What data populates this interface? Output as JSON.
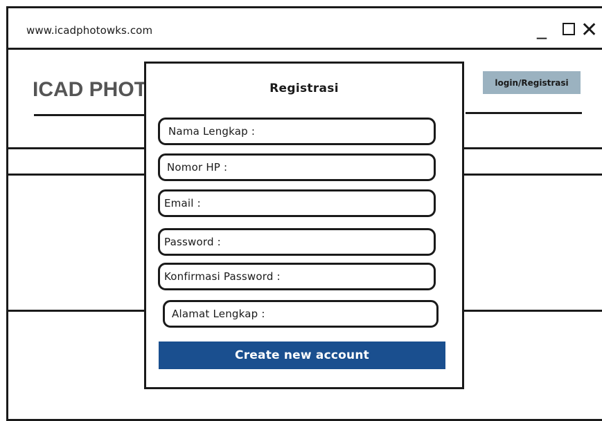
{
  "browser": {
    "url": "www.icadphotowks.com",
    "minimize_glyph": "_",
    "close_glyph": "✕"
  },
  "header": {
    "logo_text": "ICAD PHOTO",
    "login_button_label": "login/Registrasi"
  },
  "modal": {
    "title": "Registrasi",
    "fields": [
      {
        "label": "Nama Lengkap :"
      },
      {
        "label": "Nomor HP :"
      },
      {
        "label": "Email :"
      },
      {
        "label": "Password :"
      },
      {
        "label": "Konfirmasi Password :"
      },
      {
        "label": "Alamat Lengkap :"
      }
    ],
    "submit_label": "Create new account"
  },
  "colors": {
    "login_button_bg": "#9bb2c0",
    "submit_button_bg": "#1a4f8f"
  },
  "icons": [
    "minimize-icon",
    "maximize-icon",
    "close-icon"
  ]
}
